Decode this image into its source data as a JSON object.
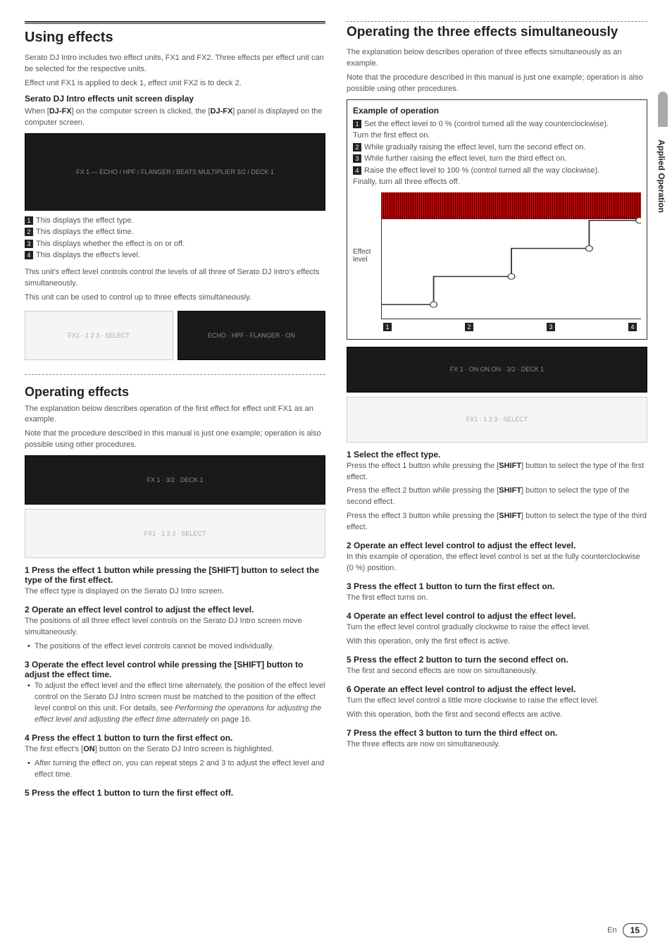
{
  "sidetab": "Applied Operation",
  "footer": {
    "lang": "En",
    "page": "15"
  },
  "left": {
    "h1": "Using effects",
    "intro1": "Serato DJ Intro includes two effect units, FX1 and FX2. Three effects per effect unit can be selected for the respective units.",
    "intro2": "Effect unit FX1 is applied to deck 1, effect unit FX2 is to deck 2.",
    "h2a": "Serato DJ Intro effects unit screen display",
    "screen_p": "When [DJ-FX] on the computer screen is clicked, the [DJ-FX] panel is displayed on the computer screen.",
    "callouts": [
      "This displays the effect type.",
      "This displays the effect time.",
      "This displays whether the effect is on or off.",
      "This displays the effect's level."
    ],
    "body1": "This unit's effect level controls control the levels of all three of Serato DJ Intro's effects simultaneously.",
    "body2": "This unit can be used to control up to three effects simultaneously.",
    "h3": "Operating effects",
    "op_p1": "The explanation below describes operation of the first effect for effect unit FX1 as an example.",
    "op_p2": "Note that the procedure described in this manual is just one example; operation is also possible using other procedures.",
    "steps": {
      "s1_h": "1   Press the effect 1 button while pressing the [SHIFT] button to select the type of the first effect.",
      "s1_p": "The effect type is displayed on the Serato DJ Intro screen.",
      "s2_h": "2   Operate an effect level control to adjust the effect level.",
      "s2_p": "The positions of all three effect level controls on the Serato DJ Intro screen move simultaneously.",
      "s2_b": "The positions of the effect level controls cannot be moved individually.",
      "s3_h": "3   Operate the effect level control while pressing the [SHIFT] button to adjust the effect time.",
      "s3_b_pre": "To adjust the effect level and the effect time alternately, the position of the effect level control on the Serato DJ Intro screen must be matched to the position of the effect level control on this unit. For details, see ",
      "s3_b_ital": "Performing the operations for adjusting the effect level and adjusting the effect time alternately",
      "s3_b_post": " on page 16.",
      "s4_h": "4   Press the effect 1 button to turn the first effect on.",
      "s4_p": "The first effect's [ON] button on the Serato DJ Intro screen is highlighted.",
      "s4_b": "After turning the effect on, you can repeat steps 2 and 3 to adjust the effect level and effect time.",
      "s5_h": "5   Press the effect 1 button to turn the first effect off."
    }
  },
  "right": {
    "h1": "Operating the three effects simultaneously",
    "p1": "The explanation below describes operation of three effects simultaneously as an example.",
    "p2": "Note that the procedure described in this manual is just one example; operation is also possible using other procedures.",
    "example": {
      "title": "Example of operation",
      "items": [
        "Set the effect level to 0 % (control turned all the way counterclockwise).\nTurn the first effect on.",
        "While gradually raising the effect level, turn the second effect on.",
        "While further raising the effect level, turn the third effect on.",
        "Raise the effect level to 100 % (control turned all the way clockwise).\nFinally, turn all three effects off."
      ],
      "graph_label": "Effect level"
    },
    "steps": {
      "s1_h": "1   Select the effect type.",
      "s1_p1": "Press the effect 1 button while pressing the [SHIFT] button to select the type of the first effect.",
      "s1_p2": "Press the effect 2 button while pressing the [SHIFT] button to select the type of the second effect.",
      "s1_p3": "Press the effect 3 button while pressing the [SHIFT] button to select the type of the third effect.",
      "s2_h": "2   Operate an effect level control to adjust the effect level.",
      "s2_p": "In this example of operation, the effect level control is set at the fully counterclockwise (0 %) position.",
      "s3_h": "3   Press the effect 1 button to turn the first effect on.",
      "s3_p": "The first effect turns on.",
      "s4_h": "4   Operate an effect level control to adjust the effect level.",
      "s4_p1": "Turn the effect level control gradually clockwise to raise the effect level.",
      "s4_p2": "With this operation, only the first effect is active.",
      "s5_h": "5   Press the effect 2 button to turn the second effect on.",
      "s5_p": "The first and second effects are now on simultaneously.",
      "s6_h": "6   Operate an effect level control to adjust the effect level.",
      "s6_p1": "Turn the effect level control a little more clockwise to raise the effect level.",
      "s6_p2": "With this operation, both the first and second effects are active.",
      "s7_h": "7   Press the effect 3 button to turn the third effect on.",
      "s7_p": "The three effects are now on simultaneously."
    }
  }
}
